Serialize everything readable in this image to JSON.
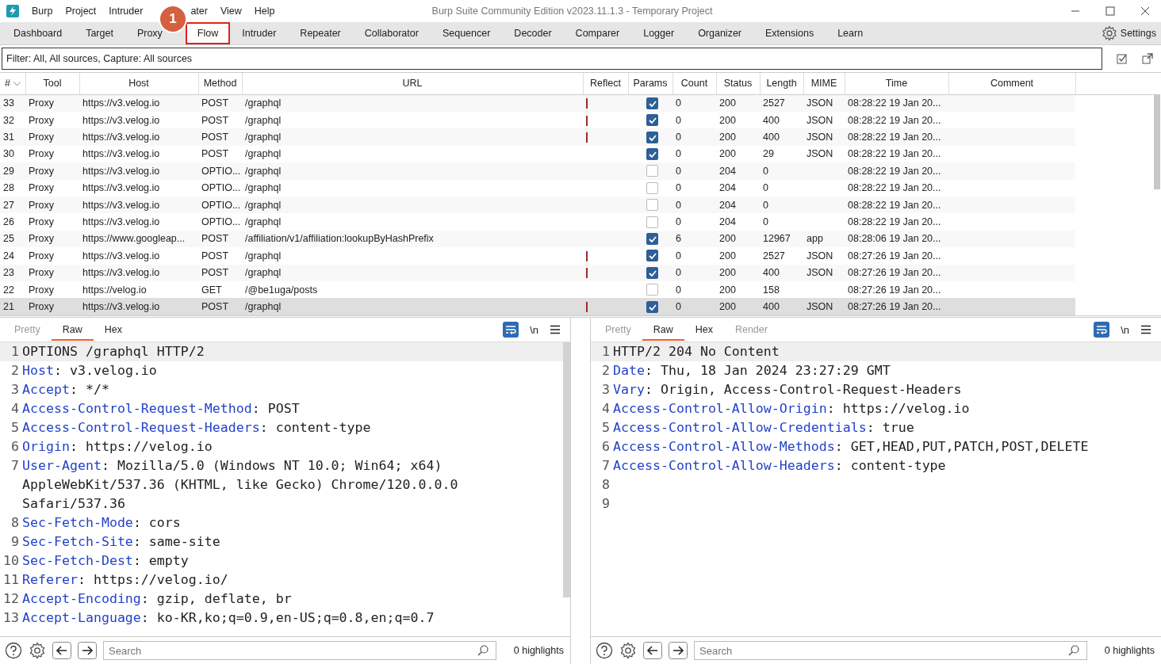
{
  "window": {
    "title": "Burp Suite Community Edition v2023.11.1.3 - Temporary Project"
  },
  "menu": [
    {
      "label": "Burp"
    },
    {
      "label": "Project"
    },
    {
      "label": "Intruder"
    },
    {
      "label": "ater"
    },
    {
      "label": "View"
    },
    {
      "label": "Help"
    }
  ],
  "callout": {
    "marker": "1"
  },
  "tabs": [
    {
      "label": "Dashboard",
      "selected": false,
      "highlighted": false
    },
    {
      "label": "Target",
      "selected": false,
      "highlighted": false
    },
    {
      "label": "Proxy",
      "selected": false,
      "highlighted": false
    },
    {
      "label": "Flow",
      "selected": true,
      "highlighted": true
    },
    {
      "label": "Intruder",
      "selected": false,
      "highlighted": false
    },
    {
      "label": "Repeater",
      "selected": false,
      "highlighted": false
    },
    {
      "label": "Collaborator",
      "selected": false,
      "highlighted": false
    },
    {
      "label": "Sequencer",
      "selected": false,
      "highlighted": false
    },
    {
      "label": "Decoder",
      "selected": false,
      "highlighted": false
    },
    {
      "label": "Comparer",
      "selected": false,
      "highlighted": false
    },
    {
      "label": "Logger",
      "selected": false,
      "highlighted": false
    },
    {
      "label": "Organizer",
      "selected": false,
      "highlighted": false
    },
    {
      "label": "Extensions",
      "selected": false,
      "highlighted": false
    },
    {
      "label": "Learn",
      "selected": false,
      "highlighted": false
    }
  ],
  "settings": {
    "label": "Settings"
  },
  "filter": {
    "text": "Filter: All, All sources, Capture: All sources"
  },
  "table": {
    "columns": [
      "#",
      "Tool",
      "Host",
      "Method",
      "URL",
      "Reflect",
      "Params",
      "Count",
      "Status",
      "Length",
      "MIME",
      "Time",
      "Comment"
    ],
    "rows": [
      {
        "id": "33",
        "tool": "Proxy",
        "host": "https://v3.velog.io",
        "method": "POST",
        "url": "/graphql",
        "reflected": true,
        "params": true,
        "count": "0",
        "status": "200",
        "length": "2527",
        "mime": "JSON",
        "time": "08:28:22 19 Jan 20...",
        "selected": false
      },
      {
        "id": "32",
        "tool": "Proxy",
        "host": "https://v3.velog.io",
        "method": "POST",
        "url": "/graphql",
        "reflected": true,
        "params": true,
        "count": "0",
        "status": "200",
        "length": "400",
        "mime": "JSON",
        "time": "08:28:22 19 Jan 20...",
        "selected": false
      },
      {
        "id": "31",
        "tool": "Proxy",
        "host": "https://v3.velog.io",
        "method": "POST",
        "url": "/graphql",
        "reflected": true,
        "params": true,
        "count": "0",
        "status": "200",
        "length": "400",
        "mime": "JSON",
        "time": "08:28:22 19 Jan 20...",
        "selected": false
      },
      {
        "id": "30",
        "tool": "Proxy",
        "host": "https://v3.velog.io",
        "method": "POST",
        "url": "/graphql",
        "reflected": false,
        "params": true,
        "count": "0",
        "status": "200",
        "length": "29",
        "mime": "JSON",
        "time": "08:28:22 19 Jan 20...",
        "selected": false
      },
      {
        "id": "29",
        "tool": "Proxy",
        "host": "https://v3.velog.io",
        "method": "OPTIO...",
        "url": "/graphql",
        "reflected": false,
        "params": false,
        "count": "0",
        "status": "204",
        "length": "0",
        "time": "08:28:22 19 Jan 20...",
        "selected": false
      },
      {
        "id": "28",
        "tool": "Proxy",
        "host": "https://v3.velog.io",
        "method": "OPTIO...",
        "url": "/graphql",
        "reflected": false,
        "params": false,
        "count": "0",
        "status": "204",
        "length": "0",
        "time": "08:28:22 19 Jan 20...",
        "selected": false
      },
      {
        "id": "27",
        "tool": "Proxy",
        "host": "https://v3.velog.io",
        "method": "OPTIO...",
        "url": "/graphql",
        "reflected": false,
        "params": false,
        "count": "0",
        "status": "204",
        "length": "0",
        "time": "08:28:22 19 Jan 20...",
        "selected": false
      },
      {
        "id": "26",
        "tool": "Proxy",
        "host": "https://v3.velog.io",
        "method": "OPTIO...",
        "url": "/graphql",
        "reflected": false,
        "params": false,
        "count": "0",
        "status": "204",
        "length": "0",
        "time": "08:28:22 19 Jan 20...",
        "selected": false
      },
      {
        "id": "25",
        "tool": "Proxy",
        "host": "https://www.googleap...",
        "method": "POST",
        "url": "/affiliation/v1/affiliation:lookupByHashPrefix",
        "reflected": false,
        "params": true,
        "count": "6",
        "status": "200",
        "length": "12967",
        "mime": "app",
        "time": "08:28:06 19 Jan 20...",
        "selected": false
      },
      {
        "id": "24",
        "tool": "Proxy",
        "host": "https://v3.velog.io",
        "method": "POST",
        "url": "/graphql",
        "reflected": true,
        "params": true,
        "count": "0",
        "status": "200",
        "length": "2527",
        "mime": "JSON",
        "time": "08:27:26 19 Jan 20...",
        "selected": false
      },
      {
        "id": "23",
        "tool": "Proxy",
        "host": "https://v3.velog.io",
        "method": "POST",
        "url": "/graphql",
        "reflected": true,
        "params": true,
        "count": "0",
        "status": "200",
        "length": "400",
        "mime": "JSON",
        "time": "08:27:26 19 Jan 20...",
        "selected": false
      },
      {
        "id": "22",
        "tool": "Proxy",
        "host": "https://velog.io",
        "method": "GET",
        "url": "/@be1uga/posts",
        "reflected": false,
        "params": false,
        "count": "0",
        "status": "200",
        "length": "158",
        "time": "08:27:26 19 Jan 20...",
        "selected": false
      },
      {
        "id": "21",
        "tool": "Proxy",
        "host": "https://v3.velog.io",
        "method": "POST",
        "url": "/graphql",
        "reflected": true,
        "params": true,
        "count": "0",
        "status": "200",
        "length": "400",
        "mime": "JSON",
        "time": "08:27:26 19 Jan 20...",
        "selected": true
      }
    ]
  },
  "panes": [
    {
      "tabs": [
        {
          "label": "Pretty",
          "selected": false,
          "disabled": true
        },
        {
          "label": "Raw",
          "selected": true,
          "disabled": false
        },
        {
          "label": "Hex",
          "selected": false,
          "disabled": false
        }
      ],
      "newline_toggle": "\\n",
      "lines": [
        {
          "num": "1",
          "text": "OPTIONS /graphql HTTP/2",
          "current": true
        },
        {
          "num": "2",
          "key": "Host",
          "text": ": v3.velog.io",
          "current": false
        },
        {
          "num": "3",
          "key": "Accept",
          "text": ": */*",
          "current": false
        },
        {
          "num": "4",
          "key": "Access-Control-Request-Method",
          "text": ": POST",
          "current": false
        },
        {
          "num": "5",
          "key": "Access-Control-Request-Headers",
          "text": ": content-type",
          "current": false
        },
        {
          "num": "6",
          "key": "Origin",
          "text": ": https://velog.io",
          "current": false
        },
        {
          "num": "7",
          "key": "User-Agent",
          "text": ": Mozilla/5.0 (Windows NT 10.0; Win64; x64) AppleWebKit/537.36 (KHTML, like Gecko) Chrome/120.0.0.0 Safari/537.36",
          "current": false
        },
        {
          "num": "8",
          "key": "Sec-Fetch-Mode",
          "text": ": cors",
          "current": false
        },
        {
          "num": "9",
          "key": "Sec-Fetch-Site",
          "text": ": same-site",
          "current": false
        },
        {
          "num": "10",
          "key": "Sec-Fetch-Dest",
          "text": ": empty",
          "current": false
        },
        {
          "num": "11",
          "key": "Referer",
          "text": ": https://velog.io/",
          "current": false
        },
        {
          "num": "12",
          "key": "Accept-Encoding",
          "text": ": gzip, deflate, br",
          "current": false
        },
        {
          "num": "13",
          "key": "Accept-Language",
          "text": ": ko-KR,ko;q=0.9,en-US;q=0.8,en;q=0.7",
          "current": false
        }
      ],
      "search": {
        "placeholder": "Search"
      },
      "highlights": "0 highlights"
    },
    {
      "tabs": [
        {
          "label": "Pretty",
          "selected": false,
          "disabled": true
        },
        {
          "label": "Raw",
          "selected": true,
          "disabled": false
        },
        {
          "label": "Hex",
          "selected": false,
          "disabled": false
        },
        {
          "label": "Render",
          "selected": false,
          "disabled": true
        }
      ],
      "newline_toggle": "\\n",
      "lines": [
        {
          "num": "1",
          "text": "HTTP/2 204 No Content",
          "current": true
        },
        {
          "num": "2",
          "key": "Date",
          "text": ": Thu, 18 Jan 2024 23:27:29 GMT",
          "current": false
        },
        {
          "num": "3",
          "key": "Vary",
          "text": ": Origin, Access-Control-Request-Headers",
          "current": false
        },
        {
          "num": "4",
          "key": "Access-Control-Allow-Origin",
          "text": ": https://velog.io",
          "current": false
        },
        {
          "num": "5",
          "key": "Access-Control-Allow-Credentials",
          "text": ": true",
          "current": false
        },
        {
          "num": "6",
          "key": "Access-Control-Allow-Methods",
          "text": ": GET,HEAD,PUT,PATCH,POST,DELETE",
          "current": false
        },
        {
          "num": "7",
          "key": "Access-Control-Allow-Headers",
          "text": ": content-type",
          "current": false
        },
        {
          "num": "8",
          "current": false
        },
        {
          "num": "9",
          "current": false
        }
      ],
      "search": {
        "placeholder": "Search"
      },
      "highlights": "0 highlights"
    }
  ]
}
